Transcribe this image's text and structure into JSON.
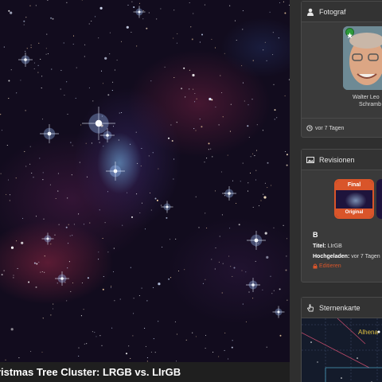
{
  "image": {
    "title": "ristmas Tree Cluster: LRGB vs. LIrGB"
  },
  "photographer": {
    "heading": "Fotograf",
    "name_line1": "Walter Leo",
    "name_line2": "Schramb",
    "time_ago": "vor 7 Tagen"
  },
  "revisions": {
    "heading": "Revisionen",
    "thumb_top_label": "Final",
    "thumb_bottom_label": "Original",
    "revision_letter": "B",
    "title_label": "Titel:",
    "title_value": "LIrGB",
    "uploaded_label": "Hochgeladen:",
    "uploaded_value": "vor 7 Tagen",
    "edit_label": "Editieren"
  },
  "skymap": {
    "heading": "Sternenkarte",
    "star_label": "Alhena"
  },
  "colors": {
    "accent": "#d9552a",
    "badge": "#2e9b3a",
    "card_bg": "#3a3a3a",
    "star_label": "#e0c040"
  },
  "icons": {
    "photographer": "user-icon",
    "time": "clock-icon",
    "revisions": "image-icon",
    "edit": "lock-icon",
    "skymap": "hand-pointer-icon",
    "badge": "star-badge-icon"
  }
}
